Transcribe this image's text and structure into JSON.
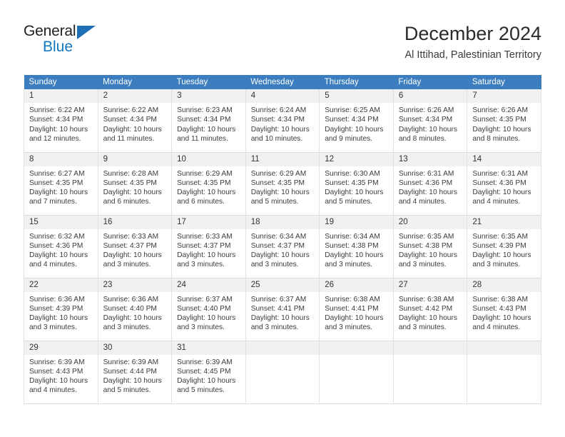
{
  "logo": {
    "word1": "General",
    "word2": "Blue",
    "triangle": "triangle-icon"
  },
  "header": {
    "title": "December 2024",
    "subtitle": "Al Ittihad, Palestinian Territory"
  },
  "colors": {
    "header_blue": "#3b7dbf",
    "logo_blue": "#1277c0",
    "daynum_bg": "#f1f1f1",
    "grid_line": "#e2e2e2"
  },
  "calendar": {
    "weekdays": [
      "Sunday",
      "Monday",
      "Tuesday",
      "Wednesday",
      "Thursday",
      "Friday",
      "Saturday"
    ],
    "labels": {
      "sunrise": "Sunrise:",
      "sunset": "Sunset:",
      "daylight": "Daylight:"
    },
    "weeks": [
      [
        {
          "day": "1",
          "sunrise": "Sunrise: 6:22 AM",
          "sunset": "Sunset: 4:34 PM",
          "daylight": "Daylight: 10 hours and 12 minutes."
        },
        {
          "day": "2",
          "sunrise": "Sunrise: 6:22 AM",
          "sunset": "Sunset: 4:34 PM",
          "daylight": "Daylight: 10 hours and 11 minutes."
        },
        {
          "day": "3",
          "sunrise": "Sunrise: 6:23 AM",
          "sunset": "Sunset: 4:34 PM",
          "daylight": "Daylight: 10 hours and 11 minutes."
        },
        {
          "day": "4",
          "sunrise": "Sunrise: 6:24 AM",
          "sunset": "Sunset: 4:34 PM",
          "daylight": "Daylight: 10 hours and 10 minutes."
        },
        {
          "day": "5",
          "sunrise": "Sunrise: 6:25 AM",
          "sunset": "Sunset: 4:34 PM",
          "daylight": "Daylight: 10 hours and 9 minutes."
        },
        {
          "day": "6",
          "sunrise": "Sunrise: 6:26 AM",
          "sunset": "Sunset: 4:34 PM",
          "daylight": "Daylight: 10 hours and 8 minutes."
        },
        {
          "day": "7",
          "sunrise": "Sunrise: 6:26 AM",
          "sunset": "Sunset: 4:35 PM",
          "daylight": "Daylight: 10 hours and 8 minutes."
        }
      ],
      [
        {
          "day": "8",
          "sunrise": "Sunrise: 6:27 AM",
          "sunset": "Sunset: 4:35 PM",
          "daylight": "Daylight: 10 hours and 7 minutes."
        },
        {
          "day": "9",
          "sunrise": "Sunrise: 6:28 AM",
          "sunset": "Sunset: 4:35 PM",
          "daylight": "Daylight: 10 hours and 6 minutes."
        },
        {
          "day": "10",
          "sunrise": "Sunrise: 6:29 AM",
          "sunset": "Sunset: 4:35 PM",
          "daylight": "Daylight: 10 hours and 6 minutes."
        },
        {
          "day": "11",
          "sunrise": "Sunrise: 6:29 AM",
          "sunset": "Sunset: 4:35 PM",
          "daylight": "Daylight: 10 hours and 5 minutes."
        },
        {
          "day": "12",
          "sunrise": "Sunrise: 6:30 AM",
          "sunset": "Sunset: 4:35 PM",
          "daylight": "Daylight: 10 hours and 5 minutes."
        },
        {
          "day": "13",
          "sunrise": "Sunrise: 6:31 AM",
          "sunset": "Sunset: 4:36 PM",
          "daylight": "Daylight: 10 hours and 4 minutes."
        },
        {
          "day": "14",
          "sunrise": "Sunrise: 6:31 AM",
          "sunset": "Sunset: 4:36 PM",
          "daylight": "Daylight: 10 hours and 4 minutes."
        }
      ],
      [
        {
          "day": "15",
          "sunrise": "Sunrise: 6:32 AM",
          "sunset": "Sunset: 4:36 PM",
          "daylight": "Daylight: 10 hours and 4 minutes."
        },
        {
          "day": "16",
          "sunrise": "Sunrise: 6:33 AM",
          "sunset": "Sunset: 4:37 PM",
          "daylight": "Daylight: 10 hours and 3 minutes."
        },
        {
          "day": "17",
          "sunrise": "Sunrise: 6:33 AM",
          "sunset": "Sunset: 4:37 PM",
          "daylight": "Daylight: 10 hours and 3 minutes."
        },
        {
          "day": "18",
          "sunrise": "Sunrise: 6:34 AM",
          "sunset": "Sunset: 4:37 PM",
          "daylight": "Daylight: 10 hours and 3 minutes."
        },
        {
          "day": "19",
          "sunrise": "Sunrise: 6:34 AM",
          "sunset": "Sunset: 4:38 PM",
          "daylight": "Daylight: 10 hours and 3 minutes."
        },
        {
          "day": "20",
          "sunrise": "Sunrise: 6:35 AM",
          "sunset": "Sunset: 4:38 PM",
          "daylight": "Daylight: 10 hours and 3 minutes."
        },
        {
          "day": "21",
          "sunrise": "Sunrise: 6:35 AM",
          "sunset": "Sunset: 4:39 PM",
          "daylight": "Daylight: 10 hours and 3 minutes."
        }
      ],
      [
        {
          "day": "22",
          "sunrise": "Sunrise: 6:36 AM",
          "sunset": "Sunset: 4:39 PM",
          "daylight": "Daylight: 10 hours and 3 minutes."
        },
        {
          "day": "23",
          "sunrise": "Sunrise: 6:36 AM",
          "sunset": "Sunset: 4:40 PM",
          "daylight": "Daylight: 10 hours and 3 minutes."
        },
        {
          "day": "24",
          "sunrise": "Sunrise: 6:37 AM",
          "sunset": "Sunset: 4:40 PM",
          "daylight": "Daylight: 10 hours and 3 minutes."
        },
        {
          "day": "25",
          "sunrise": "Sunrise: 6:37 AM",
          "sunset": "Sunset: 4:41 PM",
          "daylight": "Daylight: 10 hours and 3 minutes."
        },
        {
          "day": "26",
          "sunrise": "Sunrise: 6:38 AM",
          "sunset": "Sunset: 4:41 PM",
          "daylight": "Daylight: 10 hours and 3 minutes."
        },
        {
          "day": "27",
          "sunrise": "Sunrise: 6:38 AM",
          "sunset": "Sunset: 4:42 PM",
          "daylight": "Daylight: 10 hours and 3 minutes."
        },
        {
          "day": "28",
          "sunrise": "Sunrise: 6:38 AM",
          "sunset": "Sunset: 4:43 PM",
          "daylight": "Daylight: 10 hours and 4 minutes."
        }
      ],
      [
        {
          "day": "29",
          "sunrise": "Sunrise: 6:39 AM",
          "sunset": "Sunset: 4:43 PM",
          "daylight": "Daylight: 10 hours and 4 minutes."
        },
        {
          "day": "30",
          "sunrise": "Sunrise: 6:39 AM",
          "sunset": "Sunset: 4:44 PM",
          "daylight": "Daylight: 10 hours and 5 minutes."
        },
        {
          "day": "31",
          "sunrise": "Sunrise: 6:39 AM",
          "sunset": "Sunset: 4:45 PM",
          "daylight": "Daylight: 10 hours and 5 minutes."
        },
        {
          "day": "",
          "sunrise": "",
          "sunset": "",
          "daylight": ""
        },
        {
          "day": "",
          "sunrise": "",
          "sunset": "",
          "daylight": ""
        },
        {
          "day": "",
          "sunrise": "",
          "sunset": "",
          "daylight": ""
        },
        {
          "day": "",
          "sunrise": "",
          "sunset": "",
          "daylight": ""
        }
      ]
    ]
  }
}
